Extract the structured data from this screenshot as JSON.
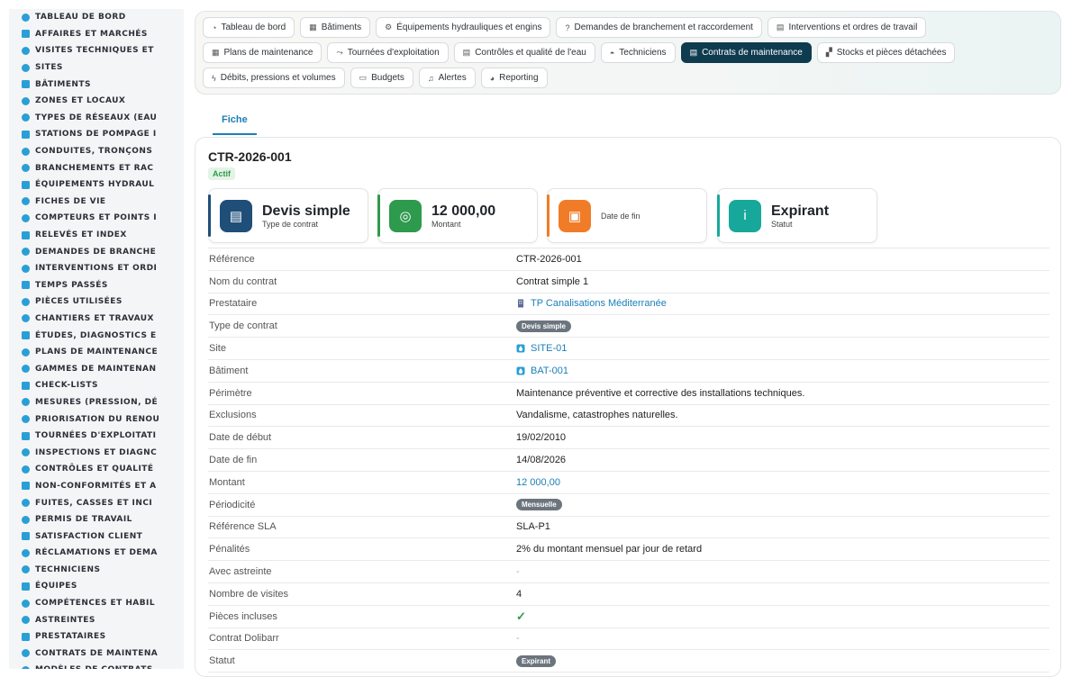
{
  "sidebar": {
    "items": [
      {
        "label": "TABLEAU DE BORD",
        "icon": "dashboard-icon"
      },
      {
        "label": "AFFAIRES ET MARCHÉS",
        "icon": "target-icon"
      },
      {
        "label": "VISITES TECHNIQUES ET",
        "icon": "eye-icon"
      },
      {
        "label": "SITES",
        "icon": "pin-icon"
      },
      {
        "label": "BÂTIMENTS",
        "icon": "building-icon"
      },
      {
        "label": "ZONES ET LOCAUX",
        "icon": "door-icon"
      },
      {
        "label": "TYPES DE RÉSEAUX (EAU",
        "icon": "network-icon"
      },
      {
        "label": "STATIONS DE POMPAGE I",
        "icon": "grid-icon"
      },
      {
        "label": "CONDUITES, TRONÇONS",
        "icon": "pipe-icon"
      },
      {
        "label": "BRANCHEMENTS ET RAC",
        "icon": "connection-icon"
      },
      {
        "label": "ÉQUIPEMENTS HYDRAUL",
        "icon": "gears-icon"
      },
      {
        "label": "FICHES DE VIE",
        "icon": "history-icon"
      },
      {
        "label": "COMPTEURS ET POINTS I",
        "icon": "gauge-icon"
      },
      {
        "label": "RELEVÉS ET INDEX",
        "icon": "list-icon"
      },
      {
        "label": "DEMANDES DE BRANCHE",
        "icon": "question-icon"
      },
      {
        "label": "INTERVENTIONS ET ORDI",
        "icon": "clipboard-icon"
      },
      {
        "label": "TEMPS PASSÉS",
        "icon": "clock-icon"
      },
      {
        "label": "PIÈCES UTILISÉES",
        "icon": "cubes-icon"
      },
      {
        "label": "CHANTIERS ET TRAVAUX",
        "icon": "hammer-icon"
      },
      {
        "label": "ÉTUDES, DIAGNOSTICS E",
        "icon": "scale-icon"
      },
      {
        "label": "PLANS DE MAINTENANCE",
        "icon": "calendar-icon"
      },
      {
        "label": "GAMMES DE MAINTENAN",
        "icon": "list-check-icon"
      },
      {
        "label": "CHECK-LISTS",
        "icon": "checklist-icon"
      },
      {
        "label": "MESURES (PRESSION, DÉ",
        "icon": "chart-icon"
      },
      {
        "label": "PRIORISATION DU RENOU",
        "icon": "chart-line-icon"
      },
      {
        "label": "TOURNÉES D'EXPLOITATI",
        "icon": "route-icon"
      },
      {
        "label": "INSPECTIONS ET DIAGNC",
        "icon": "search-icon"
      },
      {
        "label": "CONTRÔLES ET QUALITÉ",
        "icon": "clipboard-check-icon"
      },
      {
        "label": "NON-CONFORMITÉS ET A",
        "icon": "alert-circle-icon"
      },
      {
        "label": "FUITES, CASSES ET INCI",
        "icon": "warning-icon"
      },
      {
        "label": "PERMIS DE TRAVAIL",
        "icon": "file-signature-icon"
      },
      {
        "label": "SATISFACTION CLIENT",
        "icon": "smile-icon"
      },
      {
        "label": "RÉCLAMATIONS ET DEMA",
        "icon": "comment-icon"
      },
      {
        "label": "TECHNICIENS",
        "icon": "hardhat-icon"
      },
      {
        "label": "ÉQUIPES",
        "icon": "users-icon"
      },
      {
        "label": "COMPÉTENCES ET HABIL",
        "icon": "certificate-icon"
      },
      {
        "label": "ASTREINTES",
        "icon": "phone-icon"
      },
      {
        "label": "PRESTATAIRES",
        "icon": "handshake-icon"
      },
      {
        "label": "CONTRATS DE MAINTENA",
        "icon": "contract-icon"
      },
      {
        "label": "MODÈLES DE CONTRATS",
        "icon": "file-icon"
      }
    ]
  },
  "topnav": {
    "row1": [
      {
        "label": "Tableau de bord",
        "icon": "dashboard-icon",
        "glyph": "◔"
      },
      {
        "label": "Bâtiments",
        "icon": "building-icon",
        "glyph": "▦"
      },
      {
        "label": "Équipements hydrauliques et engins",
        "icon": "gears-icon",
        "glyph": "⚙"
      },
      {
        "label": "Demandes de branchement et raccordement",
        "icon": "question-icon",
        "glyph": "?"
      },
      {
        "label": "Interventions et ordres de travail",
        "icon": "clipboard-icon",
        "glyph": "▤"
      }
    ],
    "row2": [
      {
        "label": "Plans de maintenance",
        "icon": "calendar-icon",
        "glyph": "▦"
      },
      {
        "label": "Tournées d'exploitation",
        "icon": "route-icon",
        "glyph": "⤳"
      },
      {
        "label": "Contrôles et qualité de l'eau",
        "icon": "clipboard-check-icon",
        "glyph": "▤"
      },
      {
        "label": "Techniciens",
        "icon": "hardhat-icon",
        "glyph": "◓"
      },
      {
        "label": "Contrats de maintenance",
        "icon": "contract-icon",
        "glyph": "▤",
        "active": true
      },
      {
        "label": "Stocks et pièces détachées",
        "icon": "cubes-icon",
        "glyph": "▞"
      }
    ],
    "row3": [
      {
        "label": "Débits, pressions et volumes",
        "icon": "bolt-icon",
        "glyph": "ϟ"
      },
      {
        "label": "Budgets",
        "icon": "money-icon",
        "glyph": "▭"
      },
      {
        "label": "Alertes",
        "icon": "bell-icon",
        "glyph": "♫"
      },
      {
        "label": "Reporting",
        "icon": "chart-pie-icon",
        "glyph": "◕"
      }
    ]
  },
  "tabs": {
    "fiche": "Fiche"
  },
  "record": {
    "reference": "CTR-2026-001",
    "status_label": "Actif"
  },
  "kpis": [
    {
      "value": "Devis simple",
      "label": "Type de contrat",
      "color": "#1f4e79",
      "accent": "#1f4e79",
      "icon": "file-icon",
      "glyph": "▤"
    },
    {
      "value": "12 000,00",
      "label": "Montant",
      "color": "#2e9a4d",
      "accent": "#2e9a4d",
      "icon": "coins-icon",
      "glyph": "◎"
    },
    {
      "value": "",
      "label": "Date de fin",
      "color": "#f07c28",
      "accent": "#f07c28",
      "icon": "calendar-x-icon",
      "glyph": "▣"
    },
    {
      "value": "Expirant",
      "label": "Statut",
      "color": "#17a89b",
      "accent": "#17a89b",
      "icon": "info-icon",
      "glyph": "i"
    }
  ],
  "fields": [
    {
      "key": "Référence",
      "value": "CTR-2026-001",
      "type": "text"
    },
    {
      "key": "Nom du contrat",
      "value": "Contrat simple 1",
      "type": "text"
    },
    {
      "key": "Prestataire",
      "value": "TP Canalisations Méditerranée",
      "type": "link",
      "icon": "building-icon"
    },
    {
      "key": "Type de contrat",
      "value": "Devis simple",
      "type": "badge"
    },
    {
      "key": "Site",
      "value": "SITE-01",
      "type": "link",
      "icon": "site-icon"
    },
    {
      "key": "Bâtiment",
      "value": "BAT-001",
      "type": "link",
      "icon": "site-icon"
    },
    {
      "key": "Périmètre",
      "value": "Maintenance préventive et corrective des installations techniques.",
      "type": "text"
    },
    {
      "key": "Exclusions",
      "value": "Vandalisme, catastrophes naturelles.",
      "type": "text"
    },
    {
      "key": "Date de début",
      "value": "19/02/2010",
      "type": "text"
    },
    {
      "key": "Date de fin",
      "value": "14/08/2026",
      "type": "text"
    },
    {
      "key": "Montant",
      "value": "12 000,00",
      "type": "money"
    },
    {
      "key": "Périodicité",
      "value": "Mensuelle",
      "type": "badge"
    },
    {
      "key": "Référence SLA",
      "value": "SLA-P1",
      "type": "text"
    },
    {
      "key": "Pénalités",
      "value": "2% du montant mensuel par jour de retard",
      "type": "text"
    },
    {
      "key": "Avec astreinte",
      "value": "-",
      "type": "muted"
    },
    {
      "key": "Nombre de visites",
      "value": "4",
      "type": "text"
    },
    {
      "key": "Pièces incluses",
      "value": "✓",
      "type": "check"
    },
    {
      "key": "Contrat Dolibarr",
      "value": "-",
      "type": "muted"
    },
    {
      "key": "Statut",
      "value": "Expirant",
      "type": "badge"
    }
  ]
}
